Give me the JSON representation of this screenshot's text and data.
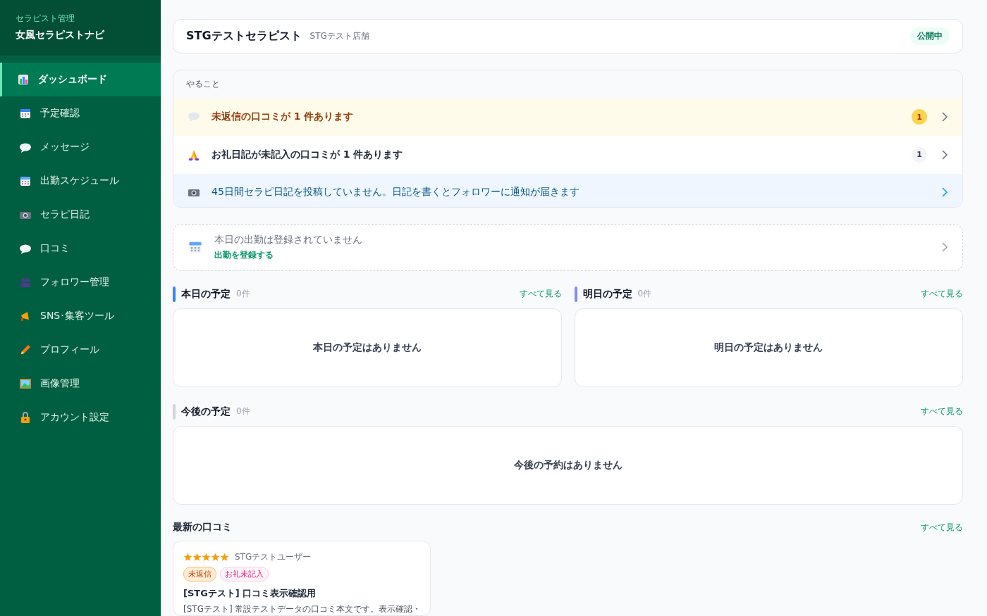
{
  "sidebar": {
    "subtitle": "セラピスト管理",
    "title": "女風セラピストナビ",
    "items": [
      {
        "label": "ダッシュボード",
        "selected": true
      },
      {
        "label": "予定確認",
        "selected": false
      },
      {
        "label": "メッセージ",
        "selected": false
      },
      {
        "label": "出勤スケジュール",
        "selected": false
      },
      {
        "label": "セラピ日記",
        "selected": false
      },
      {
        "label": "口コミ",
        "selected": false
      },
      {
        "label": "フォロワー管理",
        "selected": false
      },
      {
        "label": "SNS･集客ツール",
        "selected": false
      },
      {
        "label": "プロフィール",
        "selected": false
      },
      {
        "label": "画像管理",
        "selected": false
      },
      {
        "label": "アカウント設定",
        "selected": false
      }
    ]
  },
  "profile": {
    "name": "STGテストセラピスト",
    "shop": "STGテスト店舗",
    "status": "公開中"
  },
  "todo": {
    "title": "やること",
    "items": [
      {
        "kind": "warning",
        "text": "未返信の口コミが 1 件あります",
        "count": "1"
      },
      {
        "kind": "normal",
        "text": "お礼日記が未記入の口コミが 1 件あります",
        "count": "1"
      },
      {
        "kind": "info",
        "text": "45日間セラピ日記を投稿していません。日記を書くとフォロワーに通知が届きます"
      }
    ]
  },
  "attendance": {
    "message": "本日の出勤は登録されていません",
    "link": "出勤を登録する"
  },
  "schedules": [
    {
      "title": "本日の予定",
      "count": "0件",
      "link": "すべて見る",
      "empty": "本日の予定はありません",
      "color": "#3b82f6"
    },
    {
      "title": "明日の予定",
      "count": "0件",
      "link": "すべて見る",
      "empty": "明日の予定はありません",
      "color": "#818cf8"
    },
    {
      "title": "今後の予定",
      "count": "0件",
      "link": "すべて見る",
      "empty": "今後の予約はありません",
      "color": "#d1d5db"
    }
  ],
  "reviews": {
    "title": "最新の口コミ",
    "link": "すべて見る",
    "items": [
      {
        "stars": 5,
        "user": "STGテストユーザー",
        "tags": [
          {
            "kind": "unreplied",
            "label": "未返信"
          },
          {
            "kind": "thanks",
            "label": "お礼未記入"
          }
        ],
        "title": "[STGテスト] 口コミ表示確認用",
        "body": "[STGテスト] 常設テストデータの口コミ本文です。表示確認・"
      }
    ]
  }
}
